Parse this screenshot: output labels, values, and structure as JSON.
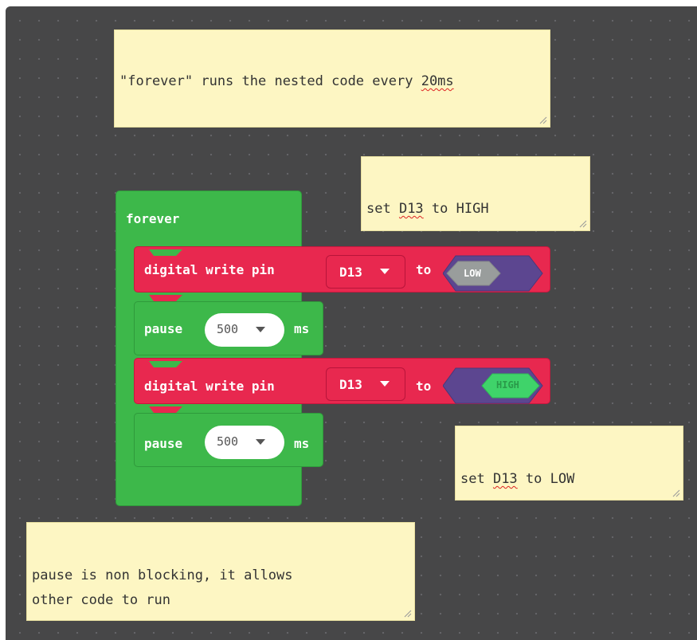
{
  "comments": {
    "forever_note": {
      "before": "\"forever\" runs the nested code every ",
      "underlined": "20ms",
      "after": ""
    },
    "high_note": {
      "before": "set ",
      "underlined": "D13",
      "after": " to HIGH"
    },
    "low_note": {
      "before": "set ",
      "underlined": "D13",
      "after": " to LOW"
    },
    "pause_note": {
      "line1": "pause is non blocking, it allows",
      "line2": "other code to run"
    }
  },
  "blocks": {
    "forever": {
      "label": "forever",
      "color": "#3db84a"
    },
    "write1": {
      "label": "digital write pin",
      "pin": "D13",
      "to": "to",
      "value": "LOW",
      "color": "#e8284f"
    },
    "pause1": {
      "label": "pause",
      "value": "500",
      "unit": "ms"
    },
    "write2": {
      "label": "digital write pin",
      "pin": "D13",
      "to": "to",
      "value": "HIGH"
    },
    "pause2": {
      "label": "pause",
      "value": "500",
      "unit": "ms"
    }
  },
  "colors": {
    "workspace": "#474748",
    "logic_purple": "#5c4690",
    "low_gray": "#999d9c",
    "high_green": "#3fd36a",
    "note_yellow": "#fdf6c3"
  }
}
